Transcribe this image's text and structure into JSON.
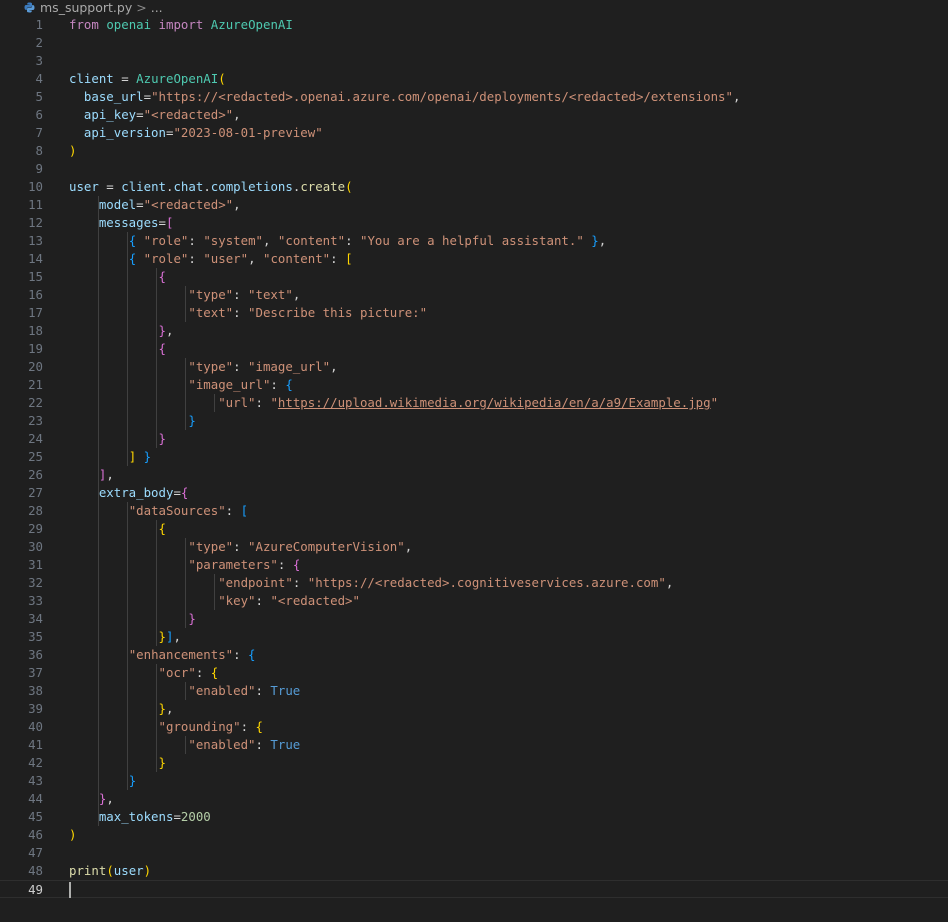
{
  "breadcrumb": {
    "file": "ms_support.py",
    "separator": ">",
    "rest": "..."
  },
  "editor": {
    "language": "python",
    "theme_colors": {
      "background": "#1f1f1f",
      "line_number": "#6e7681",
      "keyword": "#c586c0",
      "class": "#4ec9b0",
      "variable": "#9cdcfe",
      "function": "#dcdcaa",
      "string": "#ce9178",
      "number": "#b5cea8",
      "constant": "#569cd6"
    },
    "current_line": 49,
    "lines": [
      {
        "n": "1",
        "guides": [],
        "tokens": [
          [
            "kw",
            "from"
          ],
          [
            "op",
            " "
          ],
          [
            "mod",
            "openai"
          ],
          [
            "op",
            " "
          ],
          [
            "kw",
            "import"
          ],
          [
            "op",
            " "
          ],
          [
            "cls",
            "AzureOpenAI"
          ]
        ]
      },
      {
        "n": "2",
        "guides": [],
        "tokens": []
      },
      {
        "n": "3",
        "guides": [],
        "tokens": []
      },
      {
        "n": "4",
        "guides": [],
        "tokens": [
          [
            "var",
            "client"
          ],
          [
            "op",
            " = "
          ],
          [
            "cls",
            "AzureOpenAI"
          ],
          [
            "p1",
            "("
          ]
        ]
      },
      {
        "n": "5",
        "guides": [],
        "tokens": [
          [
            "op",
            "  "
          ],
          [
            "var",
            "base_url"
          ],
          [
            "op",
            "="
          ],
          [
            "str",
            "\"https://<redacted>.openai.azure.com/openai/deployments/<redacted>/extensions\""
          ],
          [
            "op",
            ","
          ]
        ]
      },
      {
        "n": "6",
        "guides": [],
        "tokens": [
          [
            "op",
            "  "
          ],
          [
            "var",
            "api_key"
          ],
          [
            "op",
            "="
          ],
          [
            "str",
            "\"<redacted>\""
          ],
          [
            "op",
            ","
          ]
        ]
      },
      {
        "n": "7",
        "guides": [],
        "tokens": [
          [
            "op",
            "  "
          ],
          [
            "var",
            "api_version"
          ],
          [
            "op",
            "="
          ],
          [
            "str",
            "\"2023-08-01-preview\""
          ]
        ]
      },
      {
        "n": "8",
        "guides": [],
        "tokens": [
          [
            "p1",
            ")"
          ]
        ]
      },
      {
        "n": "9",
        "guides": [],
        "tokens": []
      },
      {
        "n": "10",
        "guides": [],
        "tokens": [
          [
            "var",
            "user"
          ],
          [
            "op",
            " = "
          ],
          [
            "var",
            "client"
          ],
          [
            "op",
            "."
          ],
          [
            "var",
            "chat"
          ],
          [
            "op",
            "."
          ],
          [
            "var",
            "completions"
          ],
          [
            "op",
            "."
          ],
          [
            "fn",
            "create"
          ],
          [
            "p1",
            "("
          ]
        ]
      },
      {
        "n": "11",
        "guides": [
          0
        ],
        "tokens": [
          [
            "op",
            "    "
          ],
          [
            "var",
            "model"
          ],
          [
            "op",
            "="
          ],
          [
            "str",
            "\"<redacted>\""
          ],
          [
            "op",
            ","
          ]
        ]
      },
      {
        "n": "12",
        "guides": [
          0
        ],
        "tokens": [
          [
            "op",
            "    "
          ],
          [
            "var",
            "messages"
          ],
          [
            "op",
            "="
          ],
          [
            "p2",
            "["
          ]
        ]
      },
      {
        "n": "13",
        "guides": [
          0,
          1
        ],
        "tokens": [
          [
            "op",
            "        "
          ],
          [
            "p3",
            "{"
          ],
          [
            "op",
            " "
          ],
          [
            "str",
            "\"role\""
          ],
          [
            "op",
            ": "
          ],
          [
            "str",
            "\"system\""
          ],
          [
            "op",
            ", "
          ],
          [
            "str",
            "\"content\""
          ],
          [
            "op",
            ": "
          ],
          [
            "str",
            "\"You are a helpful assistant.\""
          ],
          [
            "op",
            " "
          ],
          [
            "p3",
            "}"
          ],
          [
            "op",
            ","
          ]
        ]
      },
      {
        "n": "14",
        "guides": [
          0,
          1
        ],
        "tokens": [
          [
            "op",
            "        "
          ],
          [
            "p3",
            "{"
          ],
          [
            "op",
            " "
          ],
          [
            "str",
            "\"role\""
          ],
          [
            "op",
            ": "
          ],
          [
            "str",
            "\"user\""
          ],
          [
            "op",
            ", "
          ],
          [
            "str",
            "\"content\""
          ],
          [
            "op",
            ": "
          ],
          [
            "p1",
            "["
          ]
        ]
      },
      {
        "n": "15",
        "guides": [
          0,
          1,
          2
        ],
        "tokens": [
          [
            "op",
            "            "
          ],
          [
            "p2",
            "{"
          ]
        ]
      },
      {
        "n": "16",
        "guides": [
          0,
          1,
          2,
          3
        ],
        "tokens": [
          [
            "op",
            "                "
          ],
          [
            "str",
            "\"type\""
          ],
          [
            "op",
            ": "
          ],
          [
            "str",
            "\"text\""
          ],
          [
            "op",
            ","
          ]
        ]
      },
      {
        "n": "17",
        "guides": [
          0,
          1,
          2,
          3
        ],
        "tokens": [
          [
            "op",
            "                "
          ],
          [
            "str",
            "\"text\""
          ],
          [
            "op",
            ": "
          ],
          [
            "str",
            "\"Describe this picture:\""
          ]
        ]
      },
      {
        "n": "18",
        "guides": [
          0,
          1,
          2
        ],
        "tokens": [
          [
            "op",
            "            "
          ],
          [
            "p2",
            "}"
          ],
          [
            "op",
            ","
          ]
        ]
      },
      {
        "n": "19",
        "guides": [
          0,
          1,
          2
        ],
        "tokens": [
          [
            "op",
            "            "
          ],
          [
            "p2",
            "{"
          ]
        ]
      },
      {
        "n": "20",
        "guides": [
          0,
          1,
          2,
          3
        ],
        "tokens": [
          [
            "op",
            "                "
          ],
          [
            "str",
            "\"type\""
          ],
          [
            "op",
            ": "
          ],
          [
            "str",
            "\"image_url\""
          ],
          [
            "op",
            ","
          ]
        ]
      },
      {
        "n": "21",
        "guides": [
          0,
          1,
          2,
          3
        ],
        "tokens": [
          [
            "op",
            "                "
          ],
          [
            "str",
            "\"image_url\""
          ],
          [
            "op",
            ": "
          ],
          [
            "p3",
            "{"
          ]
        ]
      },
      {
        "n": "22",
        "guides": [
          0,
          1,
          2,
          3,
          4
        ],
        "tokens": [
          [
            "op",
            "                    "
          ],
          [
            "str",
            "\"url\""
          ],
          [
            "op",
            ": "
          ],
          [
            "str",
            "\""
          ],
          [
            "str link",
            "https://upload.wikimedia.org/wikipedia/en/a/a9/Example.jpg"
          ],
          [
            "str",
            "\""
          ]
        ]
      },
      {
        "n": "23",
        "guides": [
          0,
          1,
          2,
          3
        ],
        "tokens": [
          [
            "op",
            "                "
          ],
          [
            "p3",
            "}"
          ]
        ]
      },
      {
        "n": "24",
        "guides": [
          0,
          1,
          2
        ],
        "tokens": [
          [
            "op",
            "            "
          ],
          [
            "p2",
            "}"
          ]
        ]
      },
      {
        "n": "25",
        "guides": [
          0,
          1
        ],
        "tokens": [
          [
            "op",
            "        "
          ],
          [
            "p1",
            "]"
          ],
          [
            "op",
            " "
          ],
          [
            "p3",
            "}"
          ]
        ]
      },
      {
        "n": "26",
        "guides": [
          0
        ],
        "tokens": [
          [
            "op",
            "    "
          ],
          [
            "p2",
            "]"
          ],
          [
            "op",
            ","
          ]
        ]
      },
      {
        "n": "27",
        "guides": [
          0
        ],
        "tokens": [
          [
            "op",
            "    "
          ],
          [
            "var",
            "extra_body"
          ],
          [
            "op",
            "="
          ],
          [
            "p2",
            "{"
          ]
        ]
      },
      {
        "n": "28",
        "guides": [
          0,
          1
        ],
        "tokens": [
          [
            "op",
            "        "
          ],
          [
            "str",
            "\"dataSources\""
          ],
          [
            "op",
            ": "
          ],
          [
            "p3",
            "["
          ]
        ]
      },
      {
        "n": "29",
        "guides": [
          0,
          1,
          2
        ],
        "tokens": [
          [
            "op",
            "            "
          ],
          [
            "p1",
            "{"
          ]
        ]
      },
      {
        "n": "30",
        "guides": [
          0,
          1,
          2,
          3
        ],
        "tokens": [
          [
            "op",
            "                "
          ],
          [
            "str",
            "\"type\""
          ],
          [
            "op",
            ": "
          ],
          [
            "str",
            "\"AzureComputerVision\""
          ],
          [
            "op",
            ","
          ]
        ]
      },
      {
        "n": "31",
        "guides": [
          0,
          1,
          2,
          3
        ],
        "tokens": [
          [
            "op",
            "                "
          ],
          [
            "str",
            "\"parameters\""
          ],
          [
            "op",
            ": "
          ],
          [
            "p2",
            "{"
          ]
        ]
      },
      {
        "n": "32",
        "guides": [
          0,
          1,
          2,
          3,
          4
        ],
        "tokens": [
          [
            "op",
            "                    "
          ],
          [
            "str",
            "\"endpoint\""
          ],
          [
            "op",
            ": "
          ],
          [
            "str",
            "\"https://<redacted>.cognitiveservices.azure.com\""
          ],
          [
            "op",
            ","
          ]
        ]
      },
      {
        "n": "33",
        "guides": [
          0,
          1,
          2,
          3,
          4
        ],
        "tokens": [
          [
            "op",
            "                    "
          ],
          [
            "str",
            "\"key\""
          ],
          [
            "op",
            ": "
          ],
          [
            "str",
            "\"<redacted>\""
          ]
        ]
      },
      {
        "n": "34",
        "guides": [
          0,
          1,
          2,
          3
        ],
        "tokens": [
          [
            "op",
            "                "
          ],
          [
            "p2",
            "}"
          ]
        ]
      },
      {
        "n": "35",
        "guides": [
          0,
          1,
          2
        ],
        "tokens": [
          [
            "op",
            "            "
          ],
          [
            "p1",
            "}"
          ],
          [
            "p3",
            "]"
          ],
          [
            "op",
            ","
          ]
        ]
      },
      {
        "n": "36",
        "guides": [
          0,
          1
        ],
        "tokens": [
          [
            "op",
            "        "
          ],
          [
            "str",
            "\"enhancements\""
          ],
          [
            "op",
            ": "
          ],
          [
            "p3",
            "{"
          ]
        ]
      },
      {
        "n": "37",
        "guides": [
          0,
          1,
          2
        ],
        "tokens": [
          [
            "op",
            "            "
          ],
          [
            "str",
            "\"ocr\""
          ],
          [
            "op",
            ": "
          ],
          [
            "p1",
            "{"
          ]
        ]
      },
      {
        "n": "38",
        "guides": [
          0,
          1,
          2,
          3
        ],
        "tokens": [
          [
            "op",
            "                "
          ],
          [
            "str",
            "\"enabled\""
          ],
          [
            "op",
            ": "
          ],
          [
            "cst",
            "True"
          ]
        ]
      },
      {
        "n": "39",
        "guides": [
          0,
          1,
          2
        ],
        "tokens": [
          [
            "op",
            "            "
          ],
          [
            "p1",
            "}"
          ],
          [
            "op",
            ","
          ]
        ]
      },
      {
        "n": "40",
        "guides": [
          0,
          1,
          2
        ],
        "tokens": [
          [
            "op",
            "            "
          ],
          [
            "str",
            "\"grounding\""
          ],
          [
            "op",
            ": "
          ],
          [
            "p1",
            "{"
          ]
        ]
      },
      {
        "n": "41",
        "guides": [
          0,
          1,
          2,
          3
        ],
        "tokens": [
          [
            "op",
            "                "
          ],
          [
            "str",
            "\"enabled\""
          ],
          [
            "op",
            ": "
          ],
          [
            "cst",
            "True"
          ]
        ]
      },
      {
        "n": "42",
        "guides": [
          0,
          1,
          2
        ],
        "tokens": [
          [
            "op",
            "            "
          ],
          [
            "p1",
            "}"
          ]
        ]
      },
      {
        "n": "43",
        "guides": [
          0,
          1
        ],
        "tokens": [
          [
            "op",
            "        "
          ],
          [
            "p3",
            "}"
          ]
        ]
      },
      {
        "n": "44",
        "guides": [
          0
        ],
        "tokens": [
          [
            "op",
            "    "
          ],
          [
            "p2",
            "}"
          ],
          [
            "op",
            ","
          ]
        ]
      },
      {
        "n": "45",
        "guides": [
          0
        ],
        "tokens": [
          [
            "op",
            "    "
          ],
          [
            "var",
            "max_tokens"
          ],
          [
            "op",
            "="
          ],
          [
            "num",
            "2000"
          ]
        ]
      },
      {
        "n": "46",
        "guides": [],
        "tokens": [
          [
            "p1",
            ")"
          ]
        ]
      },
      {
        "n": "47",
        "guides": [],
        "tokens": []
      },
      {
        "n": "48",
        "guides": [],
        "tokens": [
          [
            "fn",
            "print"
          ],
          [
            "p1",
            "("
          ],
          [
            "var",
            "user"
          ],
          [
            "p1",
            ")"
          ]
        ]
      },
      {
        "n": "49",
        "guides": [],
        "tokens": []
      }
    ]
  }
}
